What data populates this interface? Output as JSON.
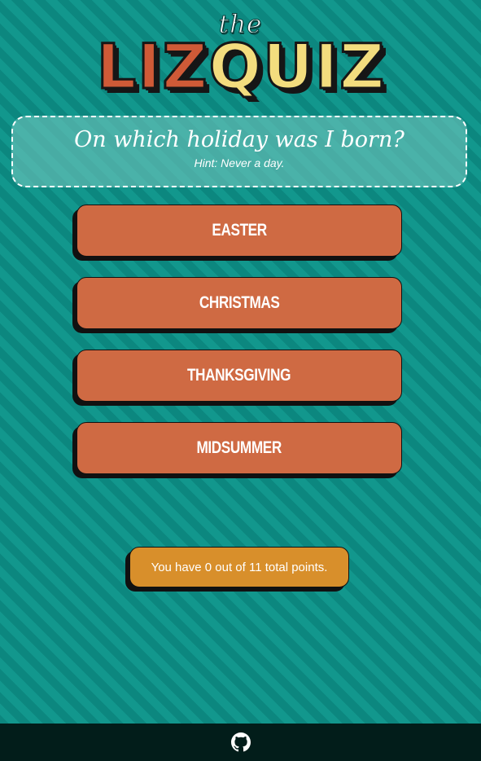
{
  "logo": {
    "the": "the",
    "letters": [
      "L",
      "I",
      "Z",
      "Q",
      "U",
      "I",
      "Z"
    ]
  },
  "question": {
    "text": "On which holiday was I born?",
    "hint": "Hint: Never a day."
  },
  "answers": [
    {
      "label": "Easter"
    },
    {
      "label": "Christmas"
    },
    {
      "label": "Thanksgiving"
    },
    {
      "label": "Midsummer"
    }
  ],
  "score": {
    "text": "You have 0 out of 11 total points."
  },
  "footer": {
    "icon": "github-icon"
  },
  "colors": {
    "background": "#109289",
    "answer_button": "#cf6a43",
    "score_box": "#d88f2b",
    "footer": "#021d1a",
    "logo_red": "#cf5a37",
    "logo_yellow": "#f3dd7e"
  }
}
